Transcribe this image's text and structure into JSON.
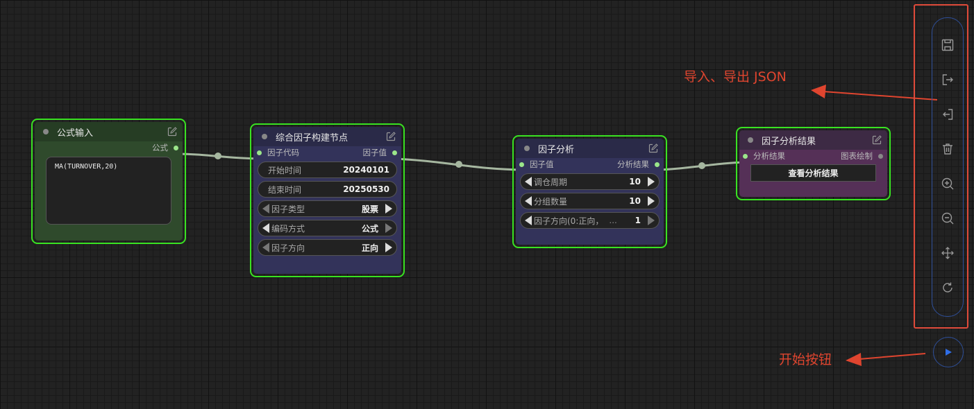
{
  "nodes": {
    "formula_input": {
      "title": "公式输入",
      "output_label": "公式",
      "formula_value": "MA(TURNOVER,20)"
    },
    "factor_builder": {
      "title": "综合因子构建节点",
      "input_label": "因子代码",
      "output_label": "因子值",
      "widgets": [
        {
          "label": "开始时间",
          "value": "20240101"
        },
        {
          "label": "结束时间",
          "value": "20250530"
        },
        {
          "label": "因子类型",
          "value": "股票"
        },
        {
          "label": "编码方式",
          "value": "公式"
        },
        {
          "label": "因子方向",
          "value": "正向"
        }
      ]
    },
    "factor_analysis": {
      "title": "因子分析",
      "input_label": "因子值",
      "output_label": "分析结果",
      "widgets": [
        {
          "label": "调仓周期",
          "value": "10"
        },
        {
          "label": "分组数量",
          "value": "10"
        },
        {
          "label": "因子方向(0:正向，",
          "ellipsis": "...",
          "value": "1"
        }
      ]
    },
    "analysis_result": {
      "title": "因子分析结果",
      "input_label": "分析结果",
      "output_label": "图表绘制",
      "button_label": "查看分析结果"
    }
  },
  "toolbar": {
    "items": [
      {
        "icon": "save-icon"
      },
      {
        "icon": "export-icon"
      },
      {
        "icon": "import-icon"
      },
      {
        "icon": "trash-icon"
      },
      {
        "icon": "zoom-in-icon"
      },
      {
        "icon": "zoom-out-icon"
      },
      {
        "icon": "move-icon"
      },
      {
        "icon": "refresh-icon"
      }
    ],
    "run_icon": "play-icon"
  },
  "annotations": {
    "import_export": "导入、导出 JSON",
    "start_button": "开始按钮"
  },
  "colors": {
    "canvas_bg": "#222222",
    "node_border_selected": "#39e322",
    "formula_node_body": "#2f4a2c",
    "builder_node_body": "#33335a",
    "result_node_body": "#553057",
    "annotation_red": "#e0452f",
    "toolbar_blue": "#2e4f9a",
    "link_color": "#a6b7a0"
  }
}
